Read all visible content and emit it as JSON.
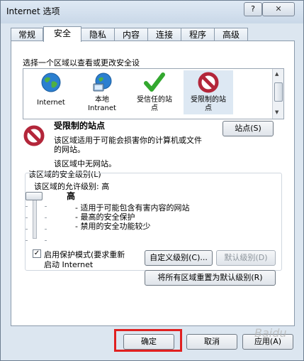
{
  "window": {
    "title": "Internet 选项",
    "help_label": "?",
    "close_label": "✕"
  },
  "tabs": [
    {
      "label": "常规"
    },
    {
      "label": "安全"
    },
    {
      "label": "隐私"
    },
    {
      "label": "内容"
    },
    {
      "label": "连接"
    },
    {
      "label": "程序"
    },
    {
      "label": "高级"
    }
  ],
  "security": {
    "select_zone_label": "选择一个区域以查看或更改安全设",
    "zones": [
      {
        "label": "Internet",
        "icon": "globe-icon"
      },
      {
        "label": "本地\nIntranet",
        "icon": "intranet-globe-icon"
      },
      {
        "label": "受信任的站\n点",
        "icon": "checkmark-icon"
      },
      {
        "label": "受限制的站\n点",
        "icon": "no-entry-icon"
      }
    ],
    "zone_title": "受限制的站点",
    "zone_desc_line1": "该区域适用于可能会损害你的计算机或文件",
    "zone_desc_line2": "的网站。",
    "zone_no_sites": "该区域中无网站。",
    "sites_button": "站点(S)",
    "level_group_label": "该区域的安全级别(L)",
    "allowed_levels": "该区域的允许级别: 高",
    "level_name": "高",
    "level_bullets": [
      "- 适用于可能包含有害内容的网站",
      "- 最高的安全保护",
      "- 禁用的安全功能较少"
    ],
    "protected_mode_line1": "启用保护模式(要求重新",
    "protected_mode_line2": "启动 Internet",
    "protected_mode_checked": true,
    "custom_level_button": "自定义级别(C)...",
    "default_level_button": "默认级别(D)",
    "reset_all_button": "将所有区域重置为默认级别(R)"
  },
  "footer": {
    "ok_button": "确定",
    "cancel_button": "取消",
    "apply_button": "应用(A)"
  },
  "watermark": "Baidu"
}
